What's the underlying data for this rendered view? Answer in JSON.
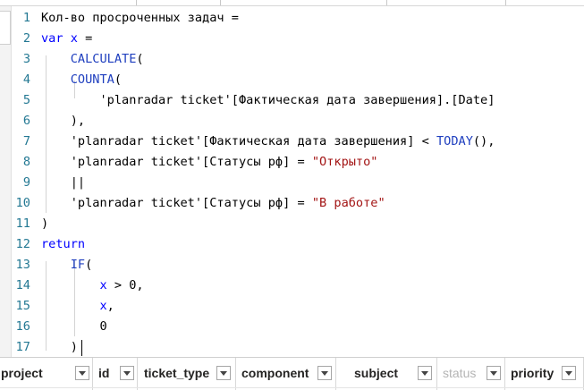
{
  "editor": {
    "lines": [
      {
        "num": "1",
        "tokens": [
          {
            "t": "Кол-во просроченных задач =",
            "c": "txt"
          }
        ]
      },
      {
        "num": "2",
        "tokens": [
          {
            "t": "var",
            "c": "kw"
          },
          {
            "t": " ",
            "c": "txt"
          },
          {
            "t": "x",
            "c": "kw"
          },
          {
            "t": " =",
            "c": "txt"
          }
        ]
      },
      {
        "num": "3",
        "tokens": [
          {
            "t": "    ",
            "c": "txt"
          },
          {
            "t": "CALCULATE",
            "c": "fn"
          },
          {
            "t": "(",
            "c": "txt"
          }
        ]
      },
      {
        "num": "4",
        "tokens": [
          {
            "t": "    ",
            "c": "txt"
          },
          {
            "t": "COUNTA",
            "c": "fn"
          },
          {
            "t": "(",
            "c": "txt"
          }
        ]
      },
      {
        "num": "5",
        "tokens": [
          {
            "t": "        'planradar ticket'[Фактическая дата завершения].[Date]",
            "c": "txt"
          }
        ]
      },
      {
        "num": "6",
        "tokens": [
          {
            "t": "    ),",
            "c": "txt"
          }
        ]
      },
      {
        "num": "7",
        "tokens": [
          {
            "t": "    'planradar ticket'[Фактическая дата завершения] < ",
            "c": "txt"
          },
          {
            "t": "TODAY",
            "c": "fn"
          },
          {
            "t": "(),",
            "c": "txt"
          }
        ]
      },
      {
        "num": "8",
        "tokens": [
          {
            "t": "    'planradar ticket'[Статусы рф] = ",
            "c": "txt"
          },
          {
            "t": "\"Открыто\"",
            "c": "str"
          }
        ]
      },
      {
        "num": "9",
        "tokens": [
          {
            "t": "    ||",
            "c": "txt"
          }
        ]
      },
      {
        "num": "10",
        "tokens": [
          {
            "t": "    'planradar ticket'[Статусы рф] = ",
            "c": "txt"
          },
          {
            "t": "\"В работе\"",
            "c": "str"
          }
        ]
      },
      {
        "num": "11",
        "tokens": [
          {
            "t": ")",
            "c": "txt"
          }
        ]
      },
      {
        "num": "12",
        "tokens": [
          {
            "t": "return",
            "c": "kw"
          }
        ]
      },
      {
        "num": "13",
        "tokens": [
          {
            "t": "    ",
            "c": "txt"
          },
          {
            "t": "IF",
            "c": "fn"
          },
          {
            "t": "(",
            "c": "txt"
          }
        ]
      },
      {
        "num": "14",
        "tokens": [
          {
            "t": "        ",
            "c": "txt"
          },
          {
            "t": "x",
            "c": "kw"
          },
          {
            "t": " > 0,",
            "c": "txt"
          }
        ]
      },
      {
        "num": "15",
        "tokens": [
          {
            "t": "        ",
            "c": "txt"
          },
          {
            "t": "x",
            "c": "kw"
          },
          {
            "t": ",",
            "c": "txt"
          }
        ]
      },
      {
        "num": "16",
        "tokens": [
          {
            "t": "        0",
            "c": "txt"
          }
        ]
      },
      {
        "num": "17",
        "tokens": [
          {
            "t": "    )",
            "c": "txt"
          }
        ]
      }
    ]
  },
  "table": {
    "columns": [
      {
        "label": "project",
        "dim": false
      },
      {
        "label": "id",
        "dim": false
      },
      {
        "label": "ticket_type",
        "dim": false
      },
      {
        "label": "component",
        "dim": false
      },
      {
        "label": "subject",
        "dim": false
      },
      {
        "label": "status",
        "dim": true
      },
      {
        "label": "priority",
        "dim": false
      }
    ]
  },
  "colors": {
    "keyword": "#0000ff",
    "function": "#1f3fbf",
    "string": "#a31515",
    "line_number": "#237893"
  }
}
